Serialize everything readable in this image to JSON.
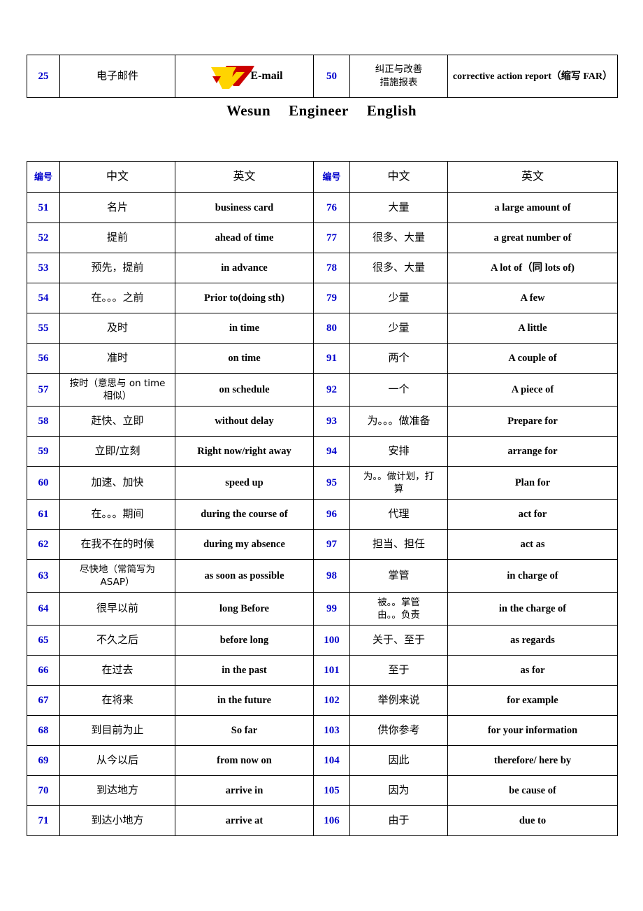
{
  "document": {
    "title": "Wesun   Engineer   English",
    "title_parts": [
      "Wesun",
      "Engineer",
      "English"
    ]
  },
  "logo": {
    "name": "wesun-logo",
    "colors": {
      "yellow": "#FFD400",
      "red": "#CC0000"
    },
    "adjacent_label": "E-mail"
  },
  "top_table": {
    "headers_implicit": [
      "编号",
      "中文",
      "英文",
      "编号",
      "中文",
      "英文"
    ],
    "rows": [
      {
        "left_no": "25",
        "left_cn": "电子邮件",
        "left_en": "E-mail",
        "left_en_has_logo": true,
        "right_no": "50",
        "right_cn": "纠正与改善措施报表",
        "right_cn_line1": "纠正与改善",
        "right_cn_line2": "措施报表",
        "right_en": "corrective action report（缩写 FAR）"
      }
    ]
  },
  "main_table": {
    "headers": {
      "no": "编号",
      "chinese": "中文",
      "english": "英文",
      "no2": "编号",
      "chinese2": "中文",
      "english2": "英文"
    },
    "rows": [
      {
        "left_no": "51",
        "left_cn": "名片",
        "left_en": "business   card",
        "right_no": "76",
        "right_cn": "大量",
        "right_en": "a   large amount of"
      },
      {
        "left_no": "52",
        "left_cn": "提前",
        "left_en": "ahead of time",
        "right_no": "77",
        "right_cn": "很多、大量",
        "right_en": "a   great   number of"
      },
      {
        "left_no": "53",
        "left_cn": "预先，提前",
        "left_en": "in   advance",
        "right_no": "78",
        "right_cn": "很多、大量",
        "right_en": "A   lot of（同 lots of)"
      },
      {
        "left_no": "54",
        "left_cn": "在。。。之前",
        "left_en": "Prior to(doing sth)",
        "right_no": "79",
        "right_cn": "少量",
        "right_en": "A   few"
      },
      {
        "left_no": "55",
        "left_cn": "及时",
        "left_en": "in time",
        "right_no": "80",
        "right_cn": "少量",
        "right_en": "A little"
      },
      {
        "left_no": "56",
        "left_cn": "准时",
        "left_en": "on time",
        "right_no": "91",
        "right_cn": "两个",
        "right_en": "A couple of"
      },
      {
        "left_no": "57",
        "left_cn": "按时（意思与 on time 相似）",
        "left_cn_line1": "按时（意思与 on time",
        "left_cn_line2": "相似）",
        "left_en": "on schedule",
        "right_no": "92",
        "right_cn": "一个",
        "right_en": "A   piece of",
        "tall": true
      },
      {
        "left_no": "58",
        "left_cn": "赶快、立即",
        "left_en": "without delay",
        "right_no": "93",
        "right_cn": "为。。。做准备",
        "right_en": "Prepare for"
      },
      {
        "left_no": "59",
        "left_cn": "立即/立刻",
        "left_en": "Right now/right away",
        "right_no": "94",
        "right_cn": "安排",
        "right_en": "arrange for"
      },
      {
        "left_no": "60",
        "left_cn": "加速、加快",
        "left_en": "speed   up",
        "right_no": "95",
        "right_cn": "为。。做计划，打算",
        "right_cn_line1": "为。。做计划，打",
        "right_cn_line2": "算",
        "right_en": "Plan for",
        "tall": true
      },
      {
        "left_no": "61",
        "left_cn": "在。。。期间",
        "left_en": "during the course of",
        "right_no": "96",
        "right_cn": "代理",
        "right_en": "act   for"
      },
      {
        "left_no": "62",
        "left_cn": "在我不在的时候",
        "left_en": "during   my   absence",
        "right_no": "97",
        "right_cn": "担当、担任",
        "right_en": "act   as"
      },
      {
        "left_no": "63",
        "left_cn": "尽快地（常简写为ASAP）",
        "left_cn_line1": "尽快地（常简写为",
        "left_cn_line2": "ASAP）",
        "left_en": "as soon as possible",
        "right_no": "98",
        "right_cn": "掌管",
        "right_en": "in charge of",
        "tall": true
      },
      {
        "left_no": "64",
        "left_cn": "很早以前",
        "left_en": "long   Before",
        "right_no": "99",
        "right_cn": "被。。掌管 由。。负责",
        "right_cn_line1": "被。。掌管",
        "right_cn_line2": "由。。负责",
        "right_en": "in the charge of",
        "tall": true
      },
      {
        "left_no": "65",
        "left_cn": "不久之后",
        "left_en": "before   long",
        "right_no": "100",
        "right_cn": "关于、至于",
        "right_en": "as   regards"
      },
      {
        "left_no": "66",
        "left_cn": "在过去",
        "left_en": "in the past",
        "right_no": "101",
        "right_cn": "至于",
        "right_en": "as   for"
      },
      {
        "left_no": "67",
        "left_cn": "在将来",
        "left_en": "in the future",
        "right_no": "102",
        "right_cn": "举例来说",
        "right_en": "for example"
      },
      {
        "left_no": "68",
        "left_cn": "到目前为止",
        "left_en": "So far",
        "right_no": "103",
        "right_cn": "供你参考",
        "right_en": "for your information"
      },
      {
        "left_no": "69",
        "left_cn": "从今以后",
        "left_en": "from now on",
        "right_no": "104",
        "right_cn": "因此",
        "right_en": "therefore/ here by"
      },
      {
        "left_no": "70",
        "left_cn": "到达地方",
        "left_en": "arrive in",
        "right_no": "105",
        "right_cn": "因为",
        "right_en": "be cause of"
      },
      {
        "left_no": "71",
        "left_cn": "到达小地方",
        "left_en": "arrive at",
        "right_no": "106",
        "right_cn": "由于",
        "right_en": "due to"
      }
    ]
  },
  "colors": {
    "number_blue": "#0000CC",
    "text_black": "#000000",
    "border": "#000000",
    "logo_yellow": "#FFD400",
    "logo_red": "#CC0000"
  }
}
